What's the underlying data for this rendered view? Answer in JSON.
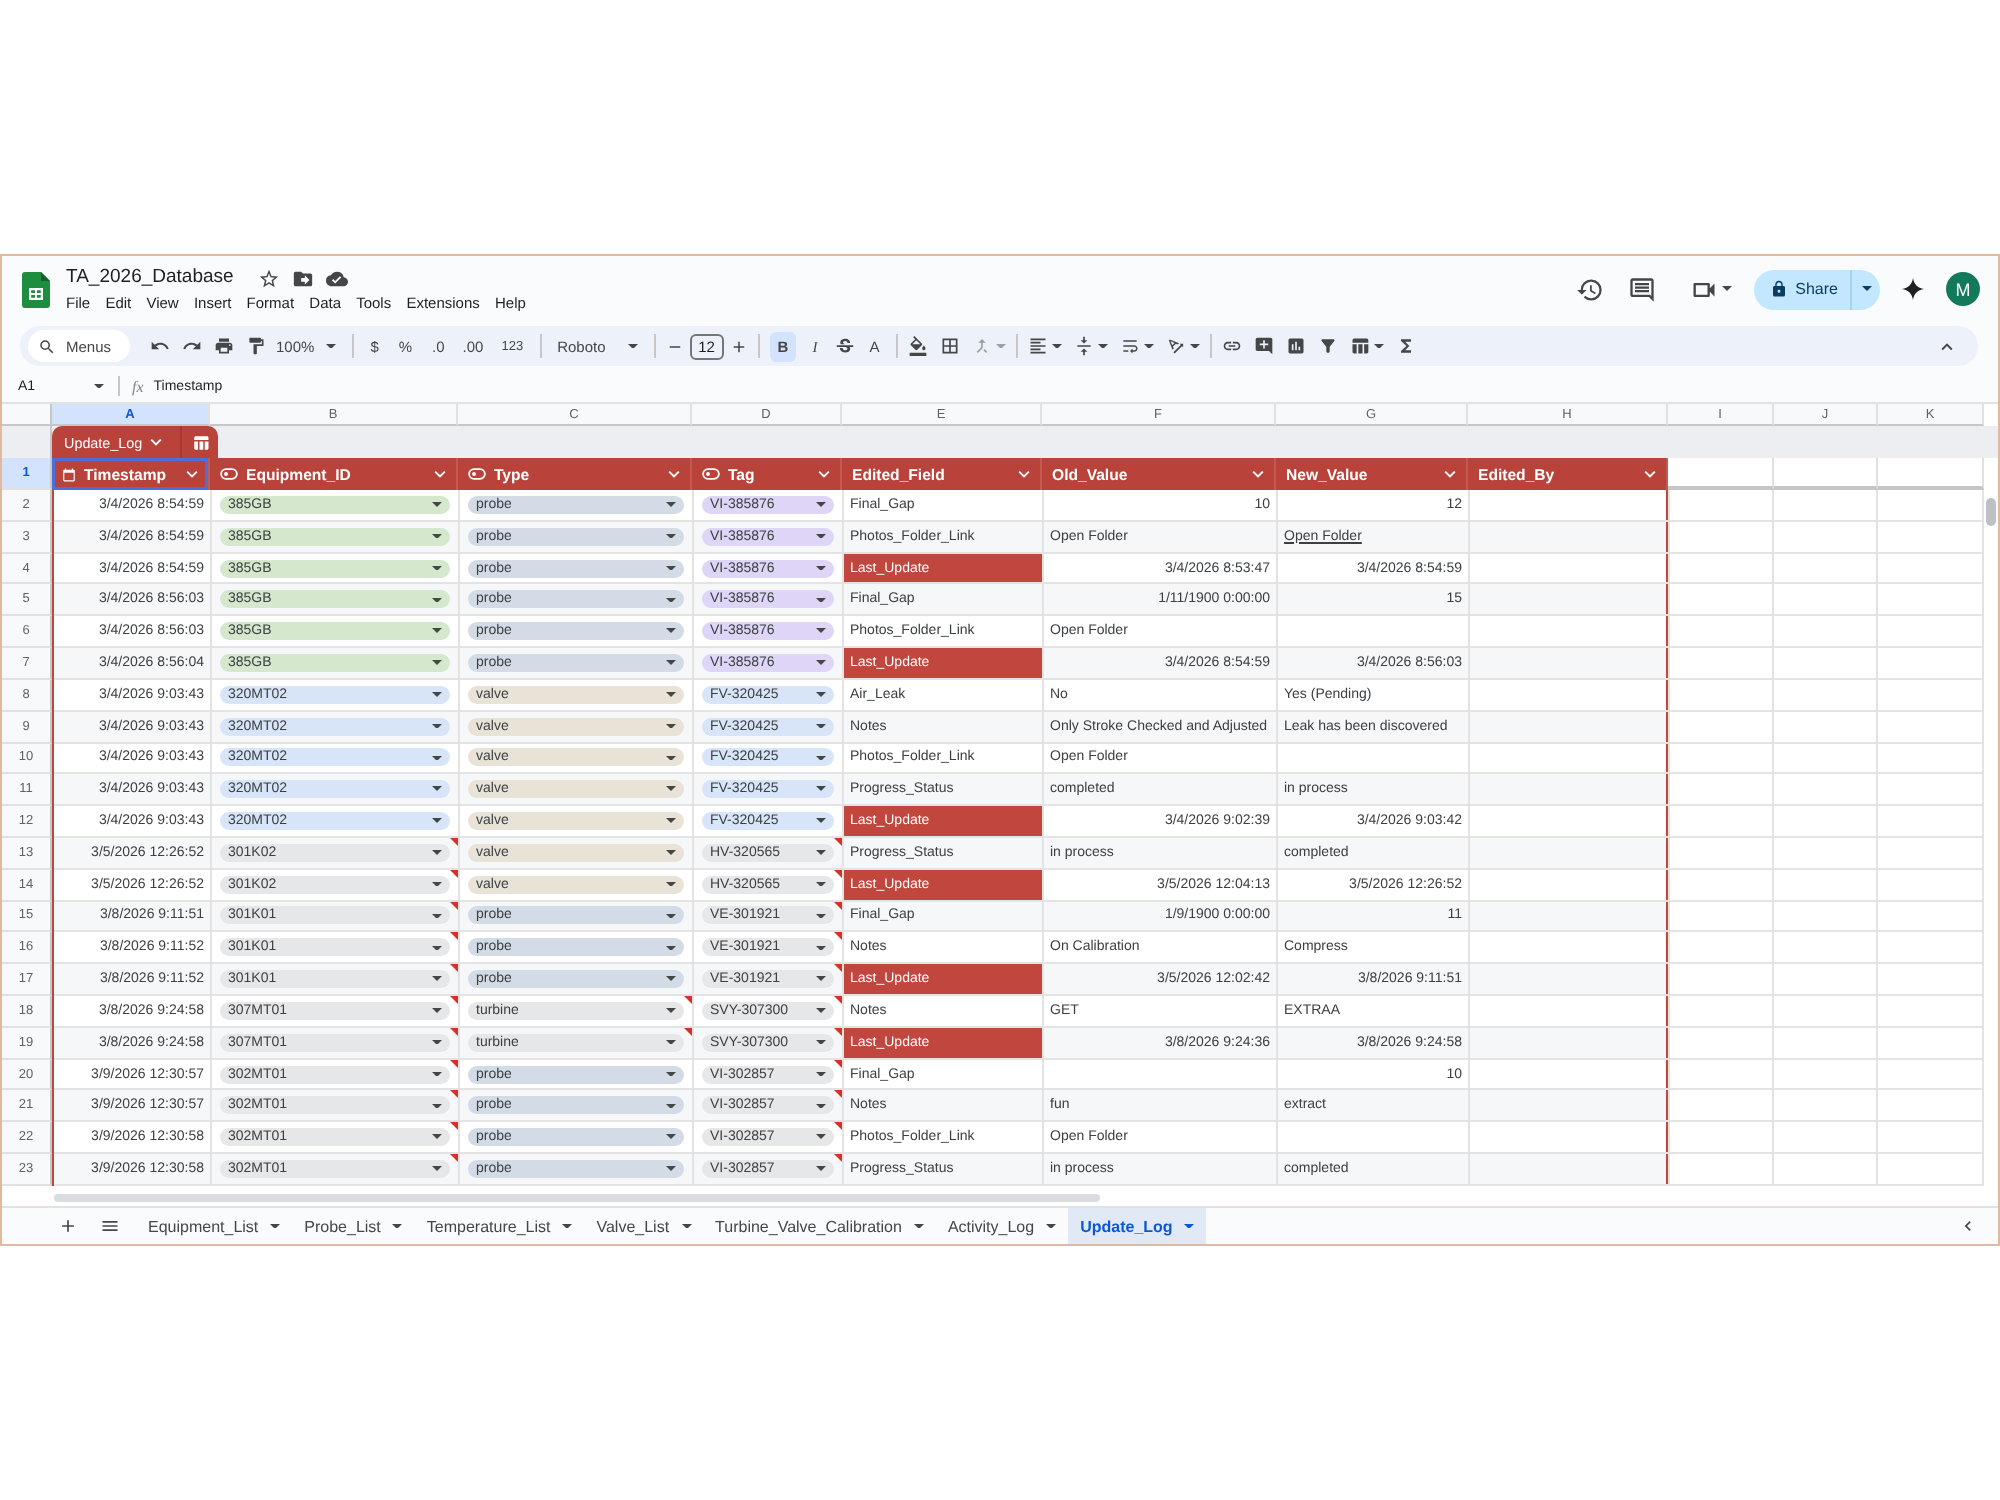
{
  "window": {
    "title": "TA_2026_Database"
  },
  "menus": [
    "File",
    "Edit",
    "View",
    "Insert",
    "Format",
    "Data",
    "Tools",
    "Extensions",
    "Help"
  ],
  "share": {
    "label": "Share"
  },
  "avatar": {
    "initial": "M"
  },
  "toolbar": {
    "search_placeholder": "Menus",
    "zoom": "100%",
    "currency": "$",
    "percent": "%",
    "decrease_decimal": ".0",
    "increase_decimal": ".00",
    "number_format": "123",
    "font": "Roboto",
    "font_size": "12",
    "bold": {
      "label": "B",
      "on": true
    },
    "italic": {
      "label": "I",
      "on": false
    },
    "strikethrough": {
      "on": false
    },
    "text_color": "A"
  },
  "formula_bar": {
    "name_box": "A1",
    "function_symbol": "fx",
    "content": "Timestamp"
  },
  "column_letters": [
    {
      "label": "A",
      "selected": true
    },
    {
      "label": "B",
      "selected": false
    },
    {
      "label": "C",
      "selected": false
    },
    {
      "label": "D",
      "selected": false
    },
    {
      "label": "E",
      "selected": false
    },
    {
      "label": "F",
      "selected": false
    },
    {
      "label": "G",
      "selected": false
    },
    {
      "label": "H",
      "selected": false
    },
    {
      "label": "I",
      "selected": false
    },
    {
      "label": "J",
      "selected": false
    },
    {
      "label": "K",
      "selected": false
    }
  ],
  "table": {
    "name": "Update_Log",
    "header_row_number": {
      "label": "1",
      "selected": true
    },
    "columns": [
      {
        "name": "Timestamp",
        "kind": "date",
        "selected": true
      },
      {
        "name": "Equipment_ID",
        "kind": "dropdown",
        "selected": false
      },
      {
        "name": "Type",
        "kind": "dropdown",
        "selected": false
      },
      {
        "name": "Tag",
        "kind": "dropdown",
        "selected": false
      },
      {
        "name": "Edited_Field",
        "kind": "text",
        "selected": false
      },
      {
        "name": "Old_Value",
        "kind": "text",
        "selected": false
      },
      {
        "name": "New_Value",
        "kind": "text",
        "selected": false
      },
      {
        "name": "Edited_By",
        "kind": "text",
        "selected": false
      }
    ],
    "rows": [
      {
        "num": "2",
        "selected": false,
        "timestamp": "3/4/2026 8:54:59",
        "equipment": {
          "text": "385GB",
          "color": "#d5e7cc",
          "invalid": false
        },
        "type": {
          "text": "probe",
          "color": "#d3dbe6",
          "invalid": false
        },
        "tag": {
          "text": "VI-385876",
          "color": "#dfd5f6",
          "invalid": false
        },
        "field": {
          "text": "Final_Gap",
          "highlighted": false
        },
        "old": {
          "text": "10",
          "kind": "number"
        },
        "new": {
          "text": "12",
          "kind": "number"
        }
      },
      {
        "num": "3",
        "selected": false,
        "timestamp": "3/4/2026 8:54:59",
        "equipment": {
          "text": "385GB",
          "color": "#d5e7cc",
          "invalid": false
        },
        "type": {
          "text": "probe",
          "color": "#d3dbe6",
          "invalid": false
        },
        "tag": {
          "text": "VI-385876",
          "color": "#dfd5f6",
          "invalid": false
        },
        "field": {
          "text": "Photos_Folder_Link",
          "highlighted": false
        },
        "old": {
          "text": "Open Folder",
          "kind": "text"
        },
        "new": {
          "text": "Open Folder",
          "kind": "link"
        }
      },
      {
        "num": "4",
        "selected": false,
        "timestamp": "3/4/2026 8:54:59",
        "equipment": {
          "text": "385GB",
          "color": "#d5e7cc",
          "invalid": false
        },
        "type": {
          "text": "probe",
          "color": "#d3dbe6",
          "invalid": false
        },
        "tag": {
          "text": "VI-385876",
          "color": "#dfd5f6",
          "invalid": false
        },
        "field": {
          "text": "Last_Update",
          "highlighted": true
        },
        "old": {
          "text": "3/4/2026 8:53:47",
          "kind": "number"
        },
        "new": {
          "text": "3/4/2026 8:54:59",
          "kind": "number"
        }
      },
      {
        "num": "5",
        "selected": false,
        "timestamp": "3/4/2026 8:56:03",
        "equipment": {
          "text": "385GB",
          "color": "#d5e7cc",
          "invalid": false
        },
        "type": {
          "text": "probe",
          "color": "#d3dbe6",
          "invalid": false
        },
        "tag": {
          "text": "VI-385876",
          "color": "#dfd5f6",
          "invalid": false
        },
        "field": {
          "text": "Final_Gap",
          "highlighted": false
        },
        "old": {
          "text": "1/11/1900 0:00:00",
          "kind": "number"
        },
        "new": {
          "text": "15",
          "kind": "number"
        }
      },
      {
        "num": "6",
        "selected": false,
        "timestamp": "3/4/2026 8:56:03",
        "equipment": {
          "text": "385GB",
          "color": "#d5e7cc",
          "invalid": false
        },
        "type": {
          "text": "probe",
          "color": "#d3dbe6",
          "invalid": false
        },
        "tag": {
          "text": "VI-385876",
          "color": "#dfd5f6",
          "invalid": false
        },
        "field": {
          "text": "Photos_Folder_Link",
          "highlighted": false
        },
        "old": {
          "text": "Open Folder",
          "kind": "text"
        }
      },
      {
        "num": "7",
        "selected": false,
        "timestamp": "3/4/2026 8:56:04",
        "equipment": {
          "text": "385GB",
          "color": "#d5e7cc",
          "invalid": false
        },
        "type": {
          "text": "probe",
          "color": "#d3dbe6",
          "invalid": false
        },
        "tag": {
          "text": "VI-385876",
          "color": "#dfd5f6",
          "invalid": false
        },
        "field": {
          "text": "Last_Update",
          "highlighted": true
        },
        "old": {
          "text": "3/4/2026 8:54:59",
          "kind": "number"
        },
        "new": {
          "text": "3/4/2026 8:56:03",
          "kind": "number"
        }
      },
      {
        "num": "8",
        "selected": false,
        "timestamp": "3/4/2026 9:03:43",
        "equipment": {
          "text": "320MT02",
          "color": "#d8e4f8",
          "invalid": false
        },
        "type": {
          "text": "valve",
          "color": "#e8e2d7",
          "invalid": false
        },
        "tag": {
          "text": "FV-320425",
          "color": "#d8e4f8",
          "invalid": false
        },
        "field": {
          "text": "Air_Leak",
          "highlighted": false
        },
        "old": {
          "text": "No",
          "kind": "text"
        },
        "new": {
          "text": "Yes (Pending)",
          "kind": "text"
        }
      },
      {
        "num": "9",
        "selected": false,
        "timestamp": "3/4/2026 9:03:43",
        "equipment": {
          "text": "320MT02",
          "color": "#d8e4f8",
          "invalid": false
        },
        "type": {
          "text": "valve",
          "color": "#e8e2d7",
          "invalid": false
        },
        "tag": {
          "text": "FV-320425",
          "color": "#d8e4f8",
          "invalid": false
        },
        "field": {
          "text": "Notes",
          "highlighted": false
        },
        "old": {
          "text": "Only Stroke Checked and Adjusted",
          "kind": "text"
        },
        "new": {
          "text": "Leak has been discovered",
          "kind": "text"
        }
      },
      {
        "num": "10",
        "selected": false,
        "timestamp": "3/4/2026 9:03:43",
        "equipment": {
          "text": "320MT02",
          "color": "#d8e4f8",
          "invalid": false
        },
        "type": {
          "text": "valve",
          "color": "#e8e2d7",
          "invalid": false
        },
        "tag": {
          "text": "FV-320425",
          "color": "#d8e4f8",
          "invalid": false
        },
        "field": {
          "text": "Photos_Folder_Link",
          "highlighted": false
        },
        "old": {
          "text": "Open Folder",
          "kind": "text"
        }
      },
      {
        "num": "11",
        "selected": false,
        "timestamp": "3/4/2026 9:03:43",
        "equipment": {
          "text": "320MT02",
          "color": "#d8e4f8",
          "invalid": false
        },
        "type": {
          "text": "valve",
          "color": "#e8e2d7",
          "invalid": false
        },
        "tag": {
          "text": "FV-320425",
          "color": "#d8e4f8",
          "invalid": false
        },
        "field": {
          "text": "Progress_Status",
          "highlighted": false
        },
        "old": {
          "text": "completed",
          "kind": "text"
        },
        "new": {
          "text": "in process",
          "kind": "text"
        }
      },
      {
        "num": "12",
        "selected": false,
        "timestamp": "3/4/2026 9:03:43",
        "equipment": {
          "text": "320MT02",
          "color": "#d8e4f8",
          "invalid": false
        },
        "type": {
          "text": "valve",
          "color": "#e8e2d7",
          "invalid": false
        },
        "tag": {
          "text": "FV-320425",
          "color": "#d8e4f8",
          "invalid": false
        },
        "field": {
          "text": "Last_Update",
          "highlighted": true
        },
        "old": {
          "text": "3/4/2026 9:02:39",
          "kind": "number"
        },
        "new": {
          "text": "3/4/2026 9:03:42",
          "kind": "number"
        }
      },
      {
        "num": "13",
        "selected": false,
        "timestamp": "3/5/2026 12:26:52",
        "equipment": {
          "text": "301K02",
          "color": "#e6e7e9",
          "invalid": true
        },
        "type": {
          "text": "valve",
          "color": "#e8e2d7",
          "invalid": false
        },
        "tag": {
          "text": "HV-320565",
          "color": "#e6e7e9",
          "invalid": true
        },
        "field": {
          "text": "Progress_Status",
          "highlighted": false
        },
        "old": {
          "text": "in process",
          "kind": "text"
        },
        "new": {
          "text": "completed",
          "kind": "text"
        }
      },
      {
        "num": "14",
        "selected": false,
        "timestamp": "3/5/2026 12:26:52",
        "equipment": {
          "text": "301K02",
          "color": "#e6e7e9",
          "invalid": true
        },
        "type": {
          "text": "valve",
          "color": "#e8e2d7",
          "invalid": false
        },
        "tag": {
          "text": "HV-320565",
          "color": "#e6e7e9",
          "invalid": true
        },
        "field": {
          "text": "Last_Update",
          "highlighted": true
        },
        "old": {
          "text": "3/5/2026 12:04:13",
          "kind": "number"
        },
        "new": {
          "text": "3/5/2026 12:26:52",
          "kind": "number"
        }
      },
      {
        "num": "15",
        "selected": false,
        "timestamp": "3/8/2026 9:11:51",
        "equipment": {
          "text": "301K01",
          "color": "#e6e7e9",
          "invalid": true
        },
        "type": {
          "text": "probe",
          "color": "#d3dbe6",
          "invalid": false
        },
        "tag": {
          "text": "VE-301921",
          "color": "#e6e7e9",
          "invalid": true
        },
        "field": {
          "text": "Final_Gap",
          "highlighted": false
        },
        "old": {
          "text": "1/9/1900 0:00:00",
          "kind": "number"
        },
        "new": {
          "text": "11",
          "kind": "number"
        }
      },
      {
        "num": "16",
        "selected": false,
        "timestamp": "3/8/2026 9:11:52",
        "equipment": {
          "text": "301K01",
          "color": "#e6e7e9",
          "invalid": true
        },
        "type": {
          "text": "probe",
          "color": "#d3dbe6",
          "invalid": false
        },
        "tag": {
          "text": "VE-301921",
          "color": "#e6e7e9",
          "invalid": true
        },
        "field": {
          "text": "Notes",
          "highlighted": false
        },
        "old": {
          "text": "On Calibration",
          "kind": "text"
        },
        "new": {
          "text": "Compress",
          "kind": "text"
        }
      },
      {
        "num": "17",
        "selected": false,
        "timestamp": "3/8/2026 9:11:52",
        "equipment": {
          "text": "301K01",
          "color": "#e6e7e9",
          "invalid": true
        },
        "type": {
          "text": "probe",
          "color": "#d3dbe6",
          "invalid": false
        },
        "tag": {
          "text": "VE-301921",
          "color": "#e6e7e9",
          "invalid": true
        },
        "field": {
          "text": "Last_Update",
          "highlighted": true
        },
        "old": {
          "text": "3/5/2026 12:02:42",
          "kind": "number"
        },
        "new": {
          "text": "3/8/2026 9:11:51",
          "kind": "number"
        }
      },
      {
        "num": "18",
        "selected": false,
        "timestamp": "3/8/2026 9:24:58",
        "equipment": {
          "text": "307MT01",
          "color": "#e6e7e9",
          "invalid": true
        },
        "type": {
          "text": "turbine",
          "color": "#e6e7e9",
          "invalid": true
        },
        "tag": {
          "text": "SVY-307300",
          "color": "#e6e7e9",
          "invalid": true
        },
        "field": {
          "text": "Notes",
          "highlighted": false
        },
        "old": {
          "text": "GET",
          "kind": "text"
        },
        "new": {
          "text": "EXTRAA",
          "kind": "text"
        }
      },
      {
        "num": "19",
        "selected": false,
        "timestamp": "3/8/2026 9:24:58",
        "equipment": {
          "text": "307MT01",
          "color": "#e6e7e9",
          "invalid": true
        },
        "type": {
          "text": "turbine",
          "color": "#e6e7e9",
          "invalid": true
        },
        "tag": {
          "text": "SVY-307300",
          "color": "#e6e7e9",
          "invalid": true
        },
        "field": {
          "text": "Last_Update",
          "highlighted": true
        },
        "old": {
          "text": "3/8/2026 9:24:36",
          "kind": "number"
        },
        "new": {
          "text": "3/8/2026 9:24:58",
          "kind": "number"
        }
      },
      {
        "num": "20",
        "selected": false,
        "timestamp": "3/9/2026 12:30:57",
        "equipment": {
          "text": "302MT01",
          "color": "#e6e7e9",
          "invalid": true
        },
        "type": {
          "text": "probe",
          "color": "#d3dbe6",
          "invalid": false
        },
        "tag": {
          "text": "VI-302857",
          "color": "#e6e7e9",
          "invalid": true
        },
        "field": {
          "text": "Final_Gap",
          "highlighted": false
        },
        "new": {
          "text": "10",
          "kind": "number"
        }
      },
      {
        "num": "21",
        "selected": false,
        "timestamp": "3/9/2026 12:30:57",
        "equipment": {
          "text": "302MT01",
          "color": "#e6e7e9",
          "invalid": true
        },
        "type": {
          "text": "probe",
          "color": "#d3dbe6",
          "invalid": false
        },
        "tag": {
          "text": "VI-302857",
          "color": "#e6e7e9",
          "invalid": true
        },
        "field": {
          "text": "Notes",
          "highlighted": false
        },
        "old": {
          "text": "fun",
          "kind": "text"
        },
        "new": {
          "text": "extract",
          "kind": "text"
        }
      },
      {
        "num": "22",
        "selected": false,
        "timestamp": "3/9/2026 12:30:58",
        "equipment": {
          "text": "302MT01",
          "color": "#e6e7e9",
          "invalid": true
        },
        "type": {
          "text": "probe",
          "color": "#d3dbe6",
          "invalid": false
        },
        "tag": {
          "text": "VI-302857",
          "color": "#e6e7e9",
          "invalid": true
        },
        "field": {
          "text": "Photos_Folder_Link",
          "highlighted": false
        },
        "old": {
          "text": "Open Folder",
          "kind": "text"
        }
      },
      {
        "num": "23",
        "selected": false,
        "timestamp": "3/9/2026 12:30:58",
        "equipment": {
          "text": "302MT01",
          "color": "#e6e7e9",
          "invalid": true
        },
        "type": {
          "text": "probe",
          "color": "#d3dbe6",
          "invalid": false
        },
        "tag": {
          "text": "VI-302857",
          "color": "#e6e7e9",
          "invalid": true
        },
        "field": {
          "text": "Progress_Status",
          "highlighted": false
        },
        "old": {
          "text": "in process",
          "kind": "text"
        },
        "new": {
          "text": "completed",
          "kind": "text"
        }
      }
    ]
  },
  "sheet_tabs": [
    {
      "label": "Equipment_List",
      "selected": false
    },
    {
      "label": "Probe_List",
      "selected": false
    },
    {
      "label": "Temperature_List",
      "selected": false
    },
    {
      "label": "Valve_List",
      "selected": false
    },
    {
      "label": "Turbine_Valve_Calibration",
      "selected": false
    },
    {
      "label": "Activity_Log",
      "selected": false
    },
    {
      "label": "Update_Log",
      "selected": true
    }
  ]
}
